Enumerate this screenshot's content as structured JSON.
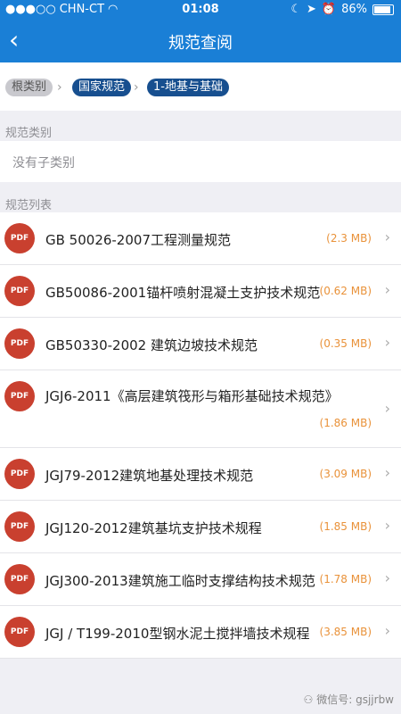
{
  "status": {
    "carrier": "CHN-CT",
    "time": "01:08",
    "battery": "86%"
  },
  "nav": {
    "back_icon": "‹",
    "title": "规范查阅"
  },
  "breadcrumb": {
    "root": "根类别",
    "level1": "国家规范",
    "level2": "1-地基与基础",
    "separator": "›"
  },
  "category": {
    "label": "规范类别",
    "empty_text": "没有子类别"
  },
  "list": {
    "label": "规范列表",
    "icon_text": "PDF",
    "chevron": "›",
    "items": [
      {
        "name": "GB 50026-2007工程测量规范",
        "size": "(2.3 MB)"
      },
      {
        "name": "GB50086-2001锚杆喷射混凝土支护技术规范",
        "size": "(0.62 MB)"
      },
      {
        "name": "GB50330-2002 建筑边坡技术规范",
        "size": "(0.35 MB)"
      },
      {
        "name": "JGJ6-2011《高层建筑筏形与箱形基础技术规范》",
        "size": "(1.86 MB)"
      },
      {
        "name": "JGJ79-2012建筑地基处理技术规范",
        "size": "(3.09 MB)"
      },
      {
        "name": "JGJ120-2012建筑基坑支护技术规程",
        "size": "(1.85 MB)"
      },
      {
        "name": "JGJ300-2013建筑施工临时支撑结构技术规范",
        "size": "(1.78 MB)"
      },
      {
        "name": "JGJ / T199-2010型钢水泥土搅拌墙技术规程",
        "size": "(3.85 MB)"
      }
    ]
  },
  "watermark": {
    "text": "微信号: gsjjrbw"
  },
  "colors": {
    "nav": "#1a7fd6",
    "crumb": "#174f8f",
    "pdf": "#c9402f",
    "size": "#e9923a"
  }
}
